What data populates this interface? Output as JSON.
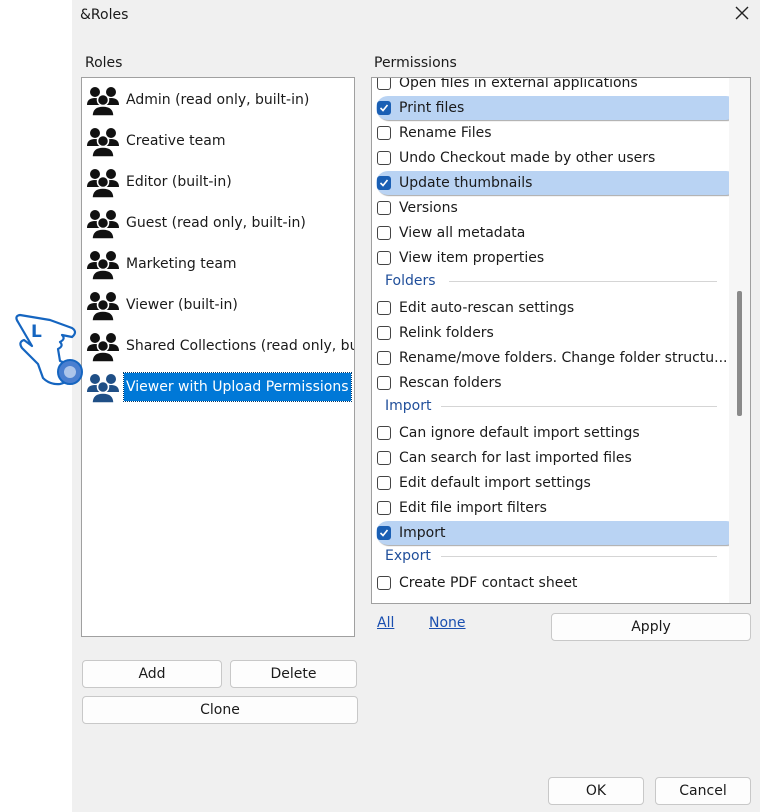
{
  "window": {
    "title": "&Roles"
  },
  "roles_panel": {
    "label": "Roles",
    "items": [
      {
        "label": "Admin (read only, built-in)"
      },
      {
        "label": "Creative team"
      },
      {
        "label": "Editor (built-in)"
      },
      {
        "label": "Guest (read only, built-in)"
      },
      {
        "label": "Marketing team"
      },
      {
        "label": "Viewer (built-in)"
      },
      {
        "label": "Shared Collections (read only, built"
      },
      {
        "label": "Viewer with Upload Permissions",
        "selected": true
      }
    ],
    "buttons": {
      "add": "Add",
      "delete": "Delete",
      "clone": "Clone"
    }
  },
  "permissions_panel": {
    "label": "Permissions",
    "rows": [
      {
        "kind": "item",
        "label": "Open files in external applications",
        "checked": false
      },
      {
        "kind": "item",
        "label": "Print files",
        "checked": true
      },
      {
        "kind": "item",
        "label": "Rename Files",
        "checked": false
      },
      {
        "kind": "item",
        "label": "Undo Checkout made by other users",
        "checked": false
      },
      {
        "kind": "item",
        "label": "Update thumbnails",
        "checked": true
      },
      {
        "kind": "item",
        "label": "Versions",
        "checked": false
      },
      {
        "kind": "item",
        "label": "View all metadata",
        "checked": false
      },
      {
        "kind": "item",
        "label": "View item properties",
        "checked": false
      },
      {
        "kind": "section",
        "label": "Folders"
      },
      {
        "kind": "item",
        "label": "Edit auto-rescan settings",
        "checked": false
      },
      {
        "kind": "item",
        "label": "Relink folders",
        "checked": false
      },
      {
        "kind": "item",
        "label": "Rename/move folders. Change folder structu...",
        "checked": false
      },
      {
        "kind": "item",
        "label": "Rescan folders",
        "checked": false
      },
      {
        "kind": "section",
        "label": "Import"
      },
      {
        "kind": "item",
        "label": "Can ignore default import settings",
        "checked": false
      },
      {
        "kind": "item",
        "label": "Can search for last imported files",
        "checked": false
      },
      {
        "kind": "item",
        "label": "Edit default import settings",
        "checked": false
      },
      {
        "kind": "item",
        "label": "Edit file import filters",
        "checked": false
      },
      {
        "kind": "item",
        "label": "Import",
        "checked": true
      },
      {
        "kind": "section",
        "label": "Export"
      },
      {
        "kind": "item",
        "label": "Create PDF contact sheet",
        "checked": false
      }
    ],
    "links": {
      "all": "All",
      "none": "None"
    },
    "apply": "Apply"
  },
  "footer": {
    "ok": "OK",
    "cancel": "Cancel"
  },
  "cursor": {
    "letter": "L",
    "icon": "hand-pointer-icon"
  },
  "colors": {
    "selection": "#0078d7",
    "highlight": "#b9d3f3",
    "checkbox": "#1a5fb4",
    "section": "#1f4e9a"
  }
}
